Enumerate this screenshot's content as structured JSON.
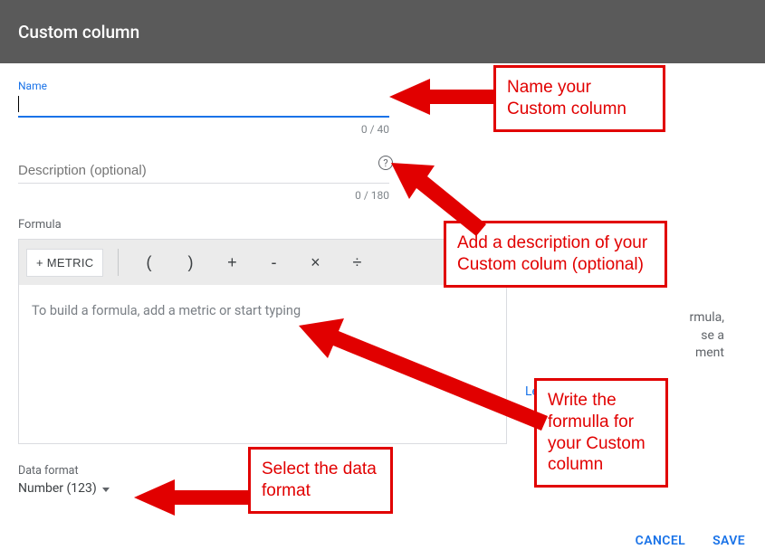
{
  "header": {
    "title": "Custom column"
  },
  "name": {
    "label": "Name",
    "value": "",
    "counter": "0 / 40"
  },
  "description": {
    "label": "Description (optional)",
    "value": "",
    "counter": "0 / 180"
  },
  "formula": {
    "label": "Formula",
    "metric_button": "+ METRIC",
    "ops": {
      "lparen": "(",
      "rparen": ")",
      "plus": "+",
      "minus": "-",
      "times": "×",
      "divide": "÷"
    },
    "placeholder": "To build a formula, add a metric or start typing"
  },
  "side_hint": "…rmula,\n…se a\n…ment",
  "learn_more": "Learn more",
  "data_format": {
    "label": "Data format",
    "value": "Number (123)"
  },
  "footer": {
    "cancel": "CANCEL",
    "save": "SAVE"
  },
  "annotations": {
    "a1": "Name your Custom column",
    "a2": "Add a description of your Custom colum (optional)",
    "a3": "Write the formulla for your Custom column",
    "a4": "Select the data format"
  }
}
